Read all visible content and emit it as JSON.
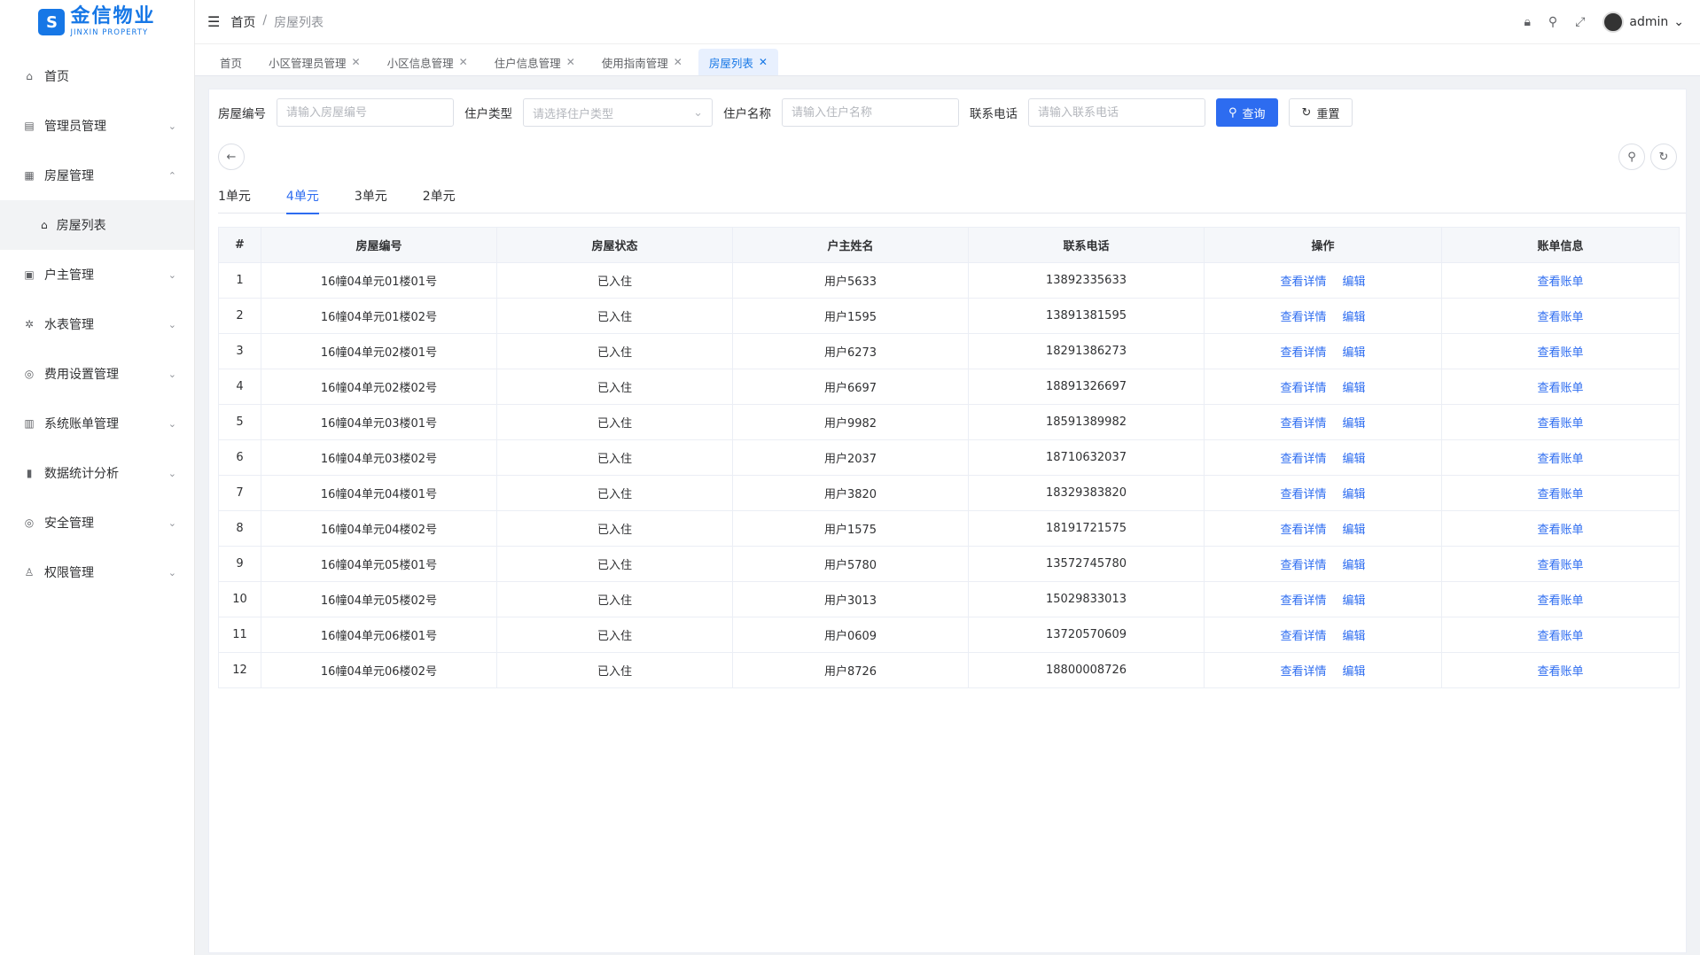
{
  "logo": {
    "mark": "S",
    "name_cn": "金信物业",
    "name_en": "JINXIN PROPERTY"
  },
  "sidebar": {
    "items": [
      {
        "label": "首页",
        "icon": "home-icon",
        "glyph": "⌂",
        "arrow": ""
      },
      {
        "label": "管理员管理",
        "icon": "admin-icon",
        "glyph": "▤",
        "arrow": "⌄"
      },
      {
        "label": "房屋管理",
        "icon": "grid-icon",
        "glyph": "▦",
        "arrow": "⌃"
      },
      {
        "label": "户主管理",
        "icon": "monitor-icon",
        "glyph": "▣",
        "arrow": "⌄"
      },
      {
        "label": "水表管理",
        "icon": "water-meter-icon",
        "glyph": "✲",
        "arrow": "⌄"
      },
      {
        "label": "费用设置管理",
        "icon": "settings-icon",
        "glyph": "◎",
        "arrow": "⌄"
      },
      {
        "label": "系统账单管理",
        "icon": "bill-icon",
        "glyph": "▥",
        "arrow": "⌄"
      },
      {
        "label": "数据统计分析",
        "icon": "chart-icon",
        "glyph": "▮",
        "arrow": "⌄"
      },
      {
        "label": "安全管理",
        "icon": "security-icon",
        "glyph": "◎",
        "arrow": "⌄"
      },
      {
        "label": "权限管理",
        "icon": "user-icon",
        "glyph": "♙",
        "arrow": "⌄"
      }
    ],
    "submenu": {
      "label": "房屋列表",
      "icon": "home-icon",
      "glyph": "⌂"
    }
  },
  "header": {
    "breadcrumb_home": "首页",
    "breadcrumb_sep": "/",
    "breadcrumb_current": "房屋列表",
    "user": "admin"
  },
  "tags": [
    {
      "label": "首页",
      "closable": false
    },
    {
      "label": "小区管理员管理",
      "closable": true
    },
    {
      "label": "小区信息管理",
      "closable": true
    },
    {
      "label": "住户信息管理",
      "closable": true
    },
    {
      "label": "使用指南管理",
      "closable": true
    },
    {
      "label": "房屋列表",
      "closable": true,
      "active": true
    }
  ],
  "filters": {
    "house_no_label": "房屋编号",
    "house_no_placeholder": "请输入房屋编号",
    "type_label": "住户类型",
    "type_placeholder": "请选择住户类型",
    "name_label": "住户名称",
    "name_placeholder": "请输入住户名称",
    "phone_label": "联系电话",
    "phone_placeholder": "请输入联系电话",
    "search_label": "查询",
    "reset_label": "重置"
  },
  "unit_tabs": [
    "1单元",
    "4单元",
    "3单元",
    "2单元"
  ],
  "active_unit": "4单元",
  "table": {
    "headers": [
      "#",
      "房屋编号",
      "房屋状态",
      "户主姓名",
      "联系电话",
      "操作",
      "账单信息"
    ],
    "action_detail": "查看详情",
    "action_edit": "编辑",
    "action_bill": "查看账单",
    "rows": [
      [
        "1",
        "16幢04单元01楼01号",
        "已入住",
        "用户5633",
        "13892335633"
      ],
      [
        "2",
        "16幢04单元01楼02号",
        "已入住",
        "用户1595",
        "13891381595"
      ],
      [
        "3",
        "16幢04单元02楼01号",
        "已入住",
        "用户6273",
        "18291386273"
      ],
      [
        "4",
        "16幢04单元02楼02号",
        "已入住",
        "用户6697",
        "18891326697"
      ],
      [
        "5",
        "16幢04单元03楼01号",
        "已入住",
        "用户9982",
        "18591389982"
      ],
      [
        "6",
        "16幢04单元03楼02号",
        "已入住",
        "用户2037",
        "18710632037"
      ],
      [
        "7",
        "16幢04单元04楼01号",
        "已入住",
        "用户3820",
        "18329383820"
      ],
      [
        "8",
        "16幢04单元04楼02号",
        "已入住",
        "用户1575",
        "18191721575"
      ],
      [
        "9",
        "16幢04单元05楼01号",
        "已入住",
        "用户5780",
        "13572745780"
      ],
      [
        "10",
        "16幢04单元05楼02号",
        "已入住",
        "用户3013",
        "15029833013"
      ],
      [
        "11",
        "16幢04单元06楼01号",
        "已入住",
        "用户0609",
        "13720570609"
      ],
      [
        "12",
        "16幢04单元06楼02号",
        "已入住",
        "用户8726",
        "18800008726"
      ]
    ]
  },
  "colors": {
    "primary": "#2d6cf0",
    "brand": "#1677e6"
  }
}
